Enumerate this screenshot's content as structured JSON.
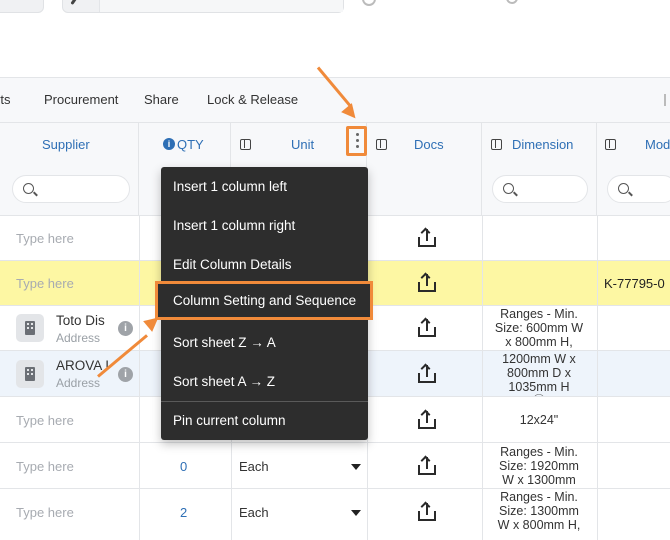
{
  "tabs": [
    {
      "label": "rts"
    },
    {
      "label": "Procurement"
    },
    {
      "label": "Share"
    },
    {
      "label": "Lock & Release"
    }
  ],
  "columns": {
    "supplier": "Supplier",
    "qty": "QTY",
    "unit": "Unit",
    "docs": "Docs",
    "dimension": "Dimension",
    "model": "Mod"
  },
  "placeholder": "Type here",
  "rows": [
    {
      "supplier": "",
      "qty": "",
      "unit": "",
      "dimension": ""
    },
    {
      "supplier": "",
      "qty": "",
      "unit": "",
      "dimension": "",
      "code": "K-77795-0"
    },
    {
      "supplier": "Toto Dis",
      "address": "Address",
      "dimension": [
        "Ranges - Min.",
        "Size: 600mm W",
        "x 800mm H,"
      ]
    },
    {
      "supplier": "AROVA I",
      "address": "Address",
      "dimension": [
        "1200mm W x",
        "800mm D x",
        "1035mm H",
        "Ⓔ"
      ]
    },
    {
      "supplier": "",
      "dimension": [
        "12x24\""
      ]
    },
    {
      "supplier": "",
      "qty": "0",
      "unit": "Each",
      "dimension": [
        "Ranges - Min.",
        "Size: 1920mm",
        "W x 1300mm"
      ]
    },
    {
      "supplier": "",
      "qty": "2",
      "unit": "Each",
      "dimension": [
        "Ranges - Min.",
        "Size: 1300mm",
        "W x 800mm H,"
      ]
    }
  ],
  "menu": {
    "items": [
      "Insert 1 column left",
      "Insert 1 column right",
      "Edit Column Details",
      "Column Setting and Sequence",
      "Sort sheet Z → A",
      "Sort sheet A → Z",
      "Pin current column"
    ],
    "highlighted_index": 3
  },
  "colors": {
    "accent": "#2e6fb5",
    "highlight": "#f08a3a",
    "row_yellow": "#fdf7a3",
    "menu_bg": "#2d2d2d"
  }
}
